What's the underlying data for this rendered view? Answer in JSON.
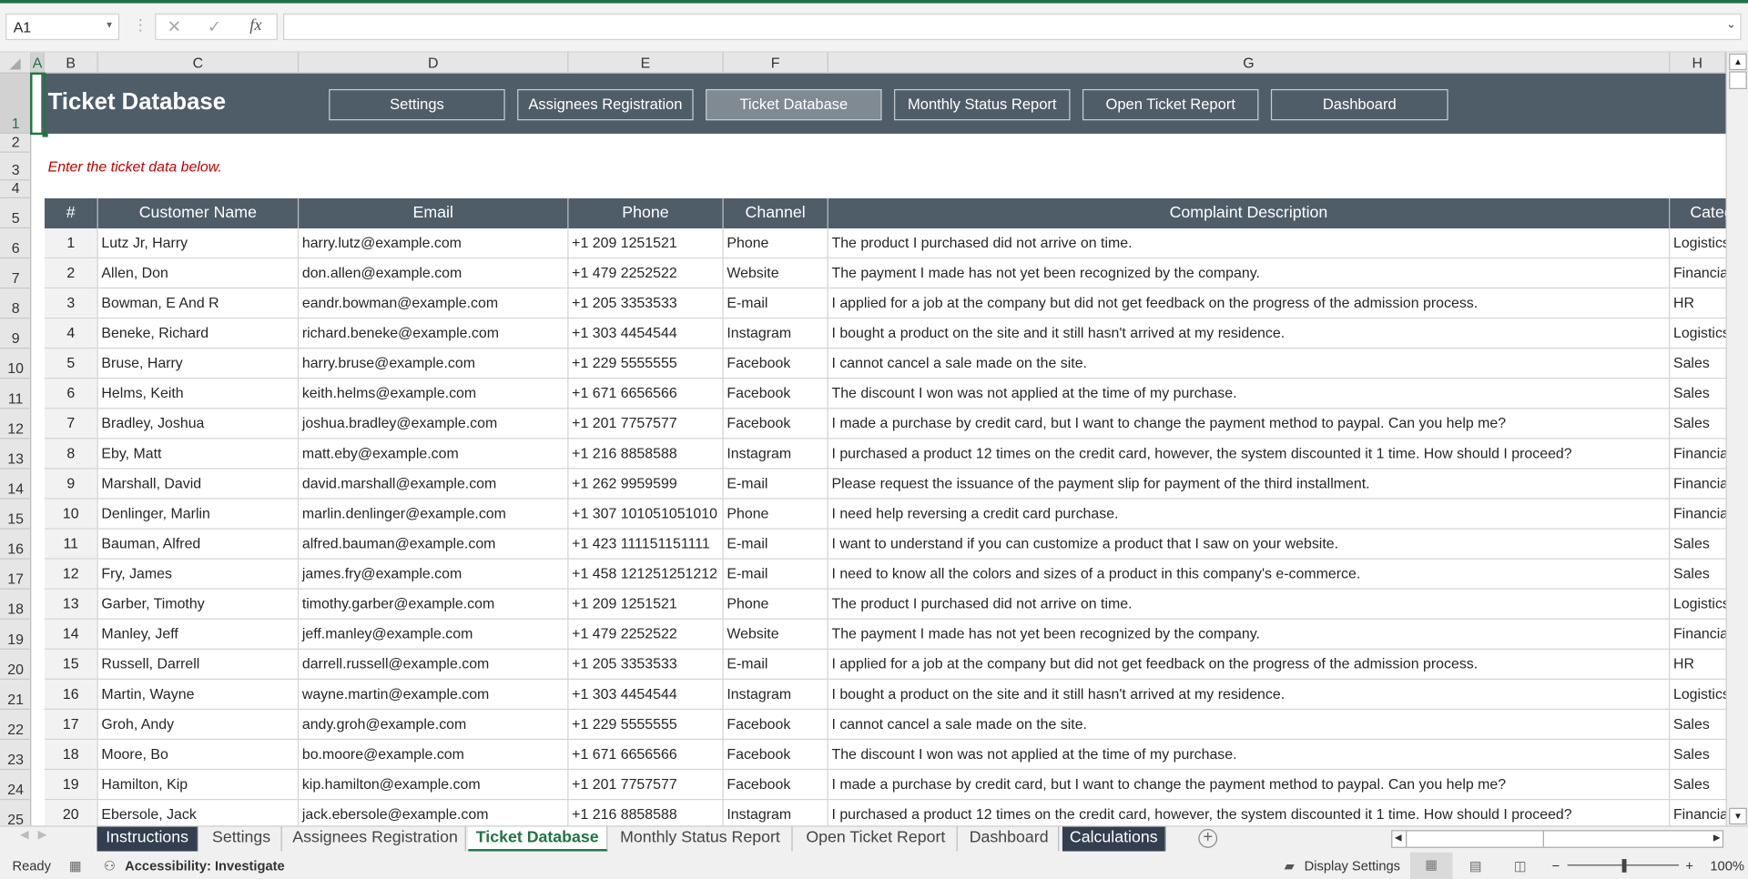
{
  "formula_bar": {
    "name_box": "A1",
    "formula": ""
  },
  "columns": [
    "A",
    "B",
    "C",
    "D",
    "E",
    "F",
    "G",
    "H"
  ],
  "rows_numbers": [
    "1",
    "2",
    "3",
    "4",
    "5",
    "6",
    "7",
    "8",
    "9",
    "10",
    "11",
    "12",
    "13",
    "14",
    "15",
    "16",
    "17",
    "18",
    "19",
    "20",
    "21",
    "22",
    "23",
    "24",
    "25"
  ],
  "banner": {
    "title": "Ticket Database",
    "buttons": [
      "Settings",
      "Assignees Registration",
      "Ticket Database",
      "Monthly Status Report",
      "Open Ticket Report",
      "Dashboard"
    ],
    "active_button": "Ticket Database"
  },
  "hint": "Enter the ticket data below.",
  "table": {
    "headers": [
      "#",
      "Customer Name",
      "Email",
      "Phone",
      "Channel",
      "Complaint Description",
      "Category"
    ],
    "rows": [
      [
        "1",
        "Lutz Jr, Harry",
        "harry.lutz@example.com",
        "+1 209 1251521",
        "Phone",
        "The product I purchased did not arrive on time.",
        "Logistics"
      ],
      [
        "2",
        "Allen, Don",
        "don.allen@example.com",
        "+1 479 2252522",
        "Website",
        "The payment I made has not yet been recognized by the company.",
        "Financial"
      ],
      [
        "3",
        "Bowman, E And R",
        "eandr.bowman@example.com",
        "+1 205 3353533",
        "E-mail",
        "I applied for a job at the company but did not get feedback on the progress of the admission process.",
        "HR"
      ],
      [
        "4",
        "Beneke, Richard",
        "richard.beneke@example.com",
        "+1 303 4454544",
        "Instagram",
        "I bought a product on the site and it still hasn't arrived at my residence.",
        "Logistics"
      ],
      [
        "5",
        "Bruse, Harry",
        "harry.bruse@example.com",
        "+1 229 5555555",
        "Facebook",
        "I cannot cancel a sale made on the site.",
        "Sales"
      ],
      [
        "6",
        "Helms, Keith",
        "keith.helms@example.com",
        "+1 671 6656566",
        "Facebook",
        "The discount I won was not applied at the time of my purchase.",
        "Sales"
      ],
      [
        "7",
        "Bradley, Joshua",
        "joshua.bradley@example.com",
        "+1 201 7757577",
        "Facebook",
        "I made a purchase by credit card, but I want to change the payment method to paypal. Can you help me?",
        "Sales"
      ],
      [
        "8",
        "Eby, Matt",
        "matt.eby@example.com",
        "+1 216 8858588",
        "Instagram",
        "I purchased a product 12 times on the credit card, however, the system discounted it 1 time. How should I proceed?",
        "Financial"
      ],
      [
        "9",
        "Marshall, David",
        "david.marshall@example.com",
        "+1 262 9959599",
        "E-mail",
        "Please request the issuance of the payment slip for payment of the third installment.",
        "Financial"
      ],
      [
        "10",
        "Denlinger, Marlin",
        "marlin.denlinger@example.com",
        "+1 307 101051051010",
        "Phone",
        "I need help reversing a credit card purchase.",
        "Financial"
      ],
      [
        "11",
        "Bauman, Alfred",
        "alfred.bauman@example.com",
        "+1 423 111151151111",
        "E-mail",
        "I want to understand if you can customize a product that I saw on your website.",
        "Sales"
      ],
      [
        "12",
        "Fry, James",
        "james.fry@example.com",
        "+1 458 121251251212",
        "E-mail",
        "I need to know all the colors and sizes of a product in this company's e-commerce.",
        "Sales"
      ],
      [
        "13",
        "Garber, Timothy",
        "timothy.garber@example.com",
        "+1 209 1251521",
        "Phone",
        "The product I purchased did not arrive on time.",
        "Logistics"
      ],
      [
        "14",
        "Manley, Jeff",
        "jeff.manley@example.com",
        "+1 479 2252522",
        "Website",
        "The payment I made has not yet been recognized by the company.",
        "Financial"
      ],
      [
        "15",
        "Russell, Darrell",
        "darrell.russell@example.com",
        "+1 205 3353533",
        "E-mail",
        "I applied for a job at the company but did not get feedback on the progress of the admission process.",
        "HR"
      ],
      [
        "16",
        "Martin, Wayne",
        "wayne.martin@example.com",
        "+1 303 4454544",
        "Instagram",
        "I bought a product on the site and it still hasn't arrived at my residence.",
        "Logistics"
      ],
      [
        "17",
        "Groh, Andy",
        "andy.groh@example.com",
        "+1 229 5555555",
        "Facebook",
        "I cannot cancel a sale made on the site.",
        "Sales"
      ],
      [
        "18",
        "Moore, Bo",
        "bo.moore@example.com",
        "+1 671 6656566",
        "Facebook",
        "The discount I won was not applied at the time of my purchase.",
        "Sales"
      ],
      [
        "19",
        "Hamilton, Kip",
        "kip.hamilton@example.com",
        "+1 201 7757577",
        "Facebook",
        "I made a purchase by credit card, but I want to change the payment method to paypal. Can you help me?",
        "Sales"
      ],
      [
        "20",
        "Ebersole, Jack",
        "jack.ebersole@example.com",
        "+1 216 8858588",
        "Instagram",
        "I purchased a product 12 times on the credit card, however, the system discounted it 1 time. How should I proceed?",
        "Financial"
      ]
    ]
  },
  "sheet_tabs": [
    "Instructions",
    "Settings",
    "Assignees Registration",
    "Ticket Database",
    "Monthly Status Report",
    "Open Ticket Report",
    "Dashboard",
    "Calculations"
  ],
  "active_tab": "Ticket Database",
  "status": {
    "ready": "Ready",
    "accessibility": "Accessibility: Investigate",
    "display_settings": "Display Settings",
    "zoom": "100%"
  },
  "colors": {
    "excel_green": "#217346",
    "banner": "#4f5d69",
    "hint_red": "#c00000",
    "dark_tab": "#333f50"
  }
}
